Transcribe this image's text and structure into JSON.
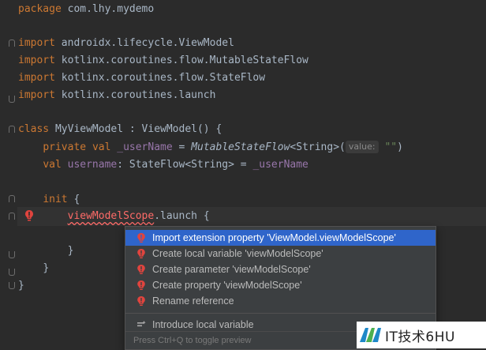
{
  "code": {
    "package_kw": "package",
    "package_name": " com.lhy.mydemo",
    "import_kw": "import",
    "imports": [
      " androidx.lifecycle.ViewModel",
      " kotlinx.coroutines.flow.MutableStateFlow",
      " kotlinx.coroutines.flow.StateFlow",
      " kotlinx.coroutines.launch"
    ],
    "class_kw": "class ",
    "class_name": "MyViewModel",
    "class_super": " : ViewModel() {",
    "private_kw": "private ",
    "val_kw": "val ",
    "field_private": "_userName",
    "eq": " = ",
    "ctor": "MutableStateFlow",
    "ctor_generic": "<String>(",
    "hint_label": "value:",
    "empty_string": "\"\"",
    "close_paren": ")",
    "field_public": "username",
    "type_decl": ": StateFlow<String> = ",
    "field_ref": "_userName",
    "init_kw": "init",
    "init_brace": " {",
    "unresolved_ref": "viewModelScope",
    "launch_call": ".launch {",
    "close_brace": "}"
  },
  "popup": {
    "items": [
      "Import extension property 'ViewModel.viewModelScope'",
      "Create local variable 'viewModelScope'",
      "Create parameter 'viewModelScope'",
      "Create property 'viewModelScope'",
      "Rename reference"
    ],
    "refactor_item": "Introduce local variable",
    "submenu_arrow": "›",
    "footer": "Press Ctrl+Q to toggle preview"
  },
  "watermark": {
    "text": "IT技术6HU"
  },
  "colors": {
    "background": "#2b2b2b",
    "keyword": "#cc7832",
    "identifier": "#a9b7c6",
    "field": "#9876aa",
    "string": "#6a8759",
    "error": "#ff6b68",
    "selection": "#2f65ca"
  }
}
